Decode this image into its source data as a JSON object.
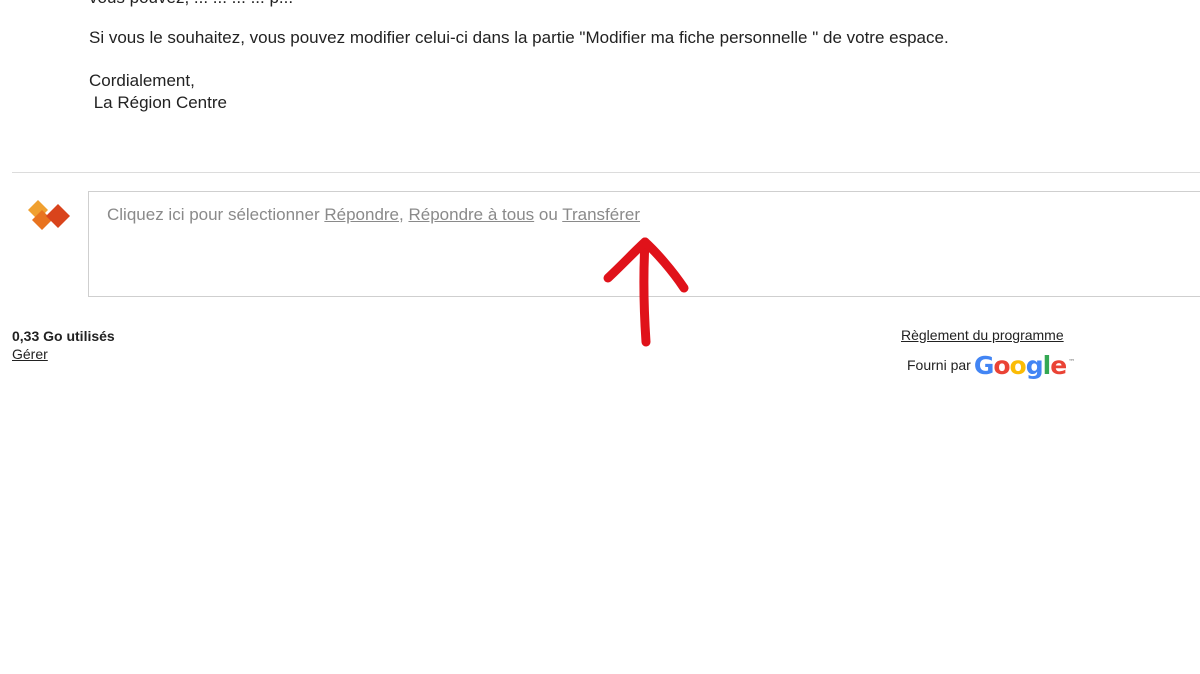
{
  "email": {
    "partial_line": "vous pouvez, ... ... ... ... p...",
    "modify_text": "Si vous le souhaitez, vous pouvez modifier celui-ci dans la partie \"Modifier ma fiche personnelle \" de votre espace.",
    "closing": "Cordialement,",
    "signature": " La Région Centre"
  },
  "reply_box": {
    "prompt_start": "Cliquez ici pour sélectionner ",
    "reply_label": "Répondre",
    "sep_comma": ", ",
    "reply_all_label": "Répondre à tous",
    "sep_or": " ou ",
    "forward_label": "Transférer"
  },
  "footer": {
    "storage_used": "0,33 Go utilisés",
    "manage_label": "Gérer",
    "program_rules_label": "Règlement du programme",
    "powered_by_label": "Fourni par",
    "google_letters": [
      "G",
      "o",
      "o",
      "g",
      "l",
      "e"
    ],
    "google_tm": "™"
  },
  "colors": {
    "avatar_front": "#d9441c",
    "avatar_back": "#f0a030",
    "annotation_arrow": "#e0121a",
    "google_blue": "#4285f4",
    "google_red": "#ea4335",
    "google_yellow": "#fbbc05",
    "google_green": "#34a853"
  },
  "annotation": {
    "icon": "red-arrow-up-icon"
  }
}
